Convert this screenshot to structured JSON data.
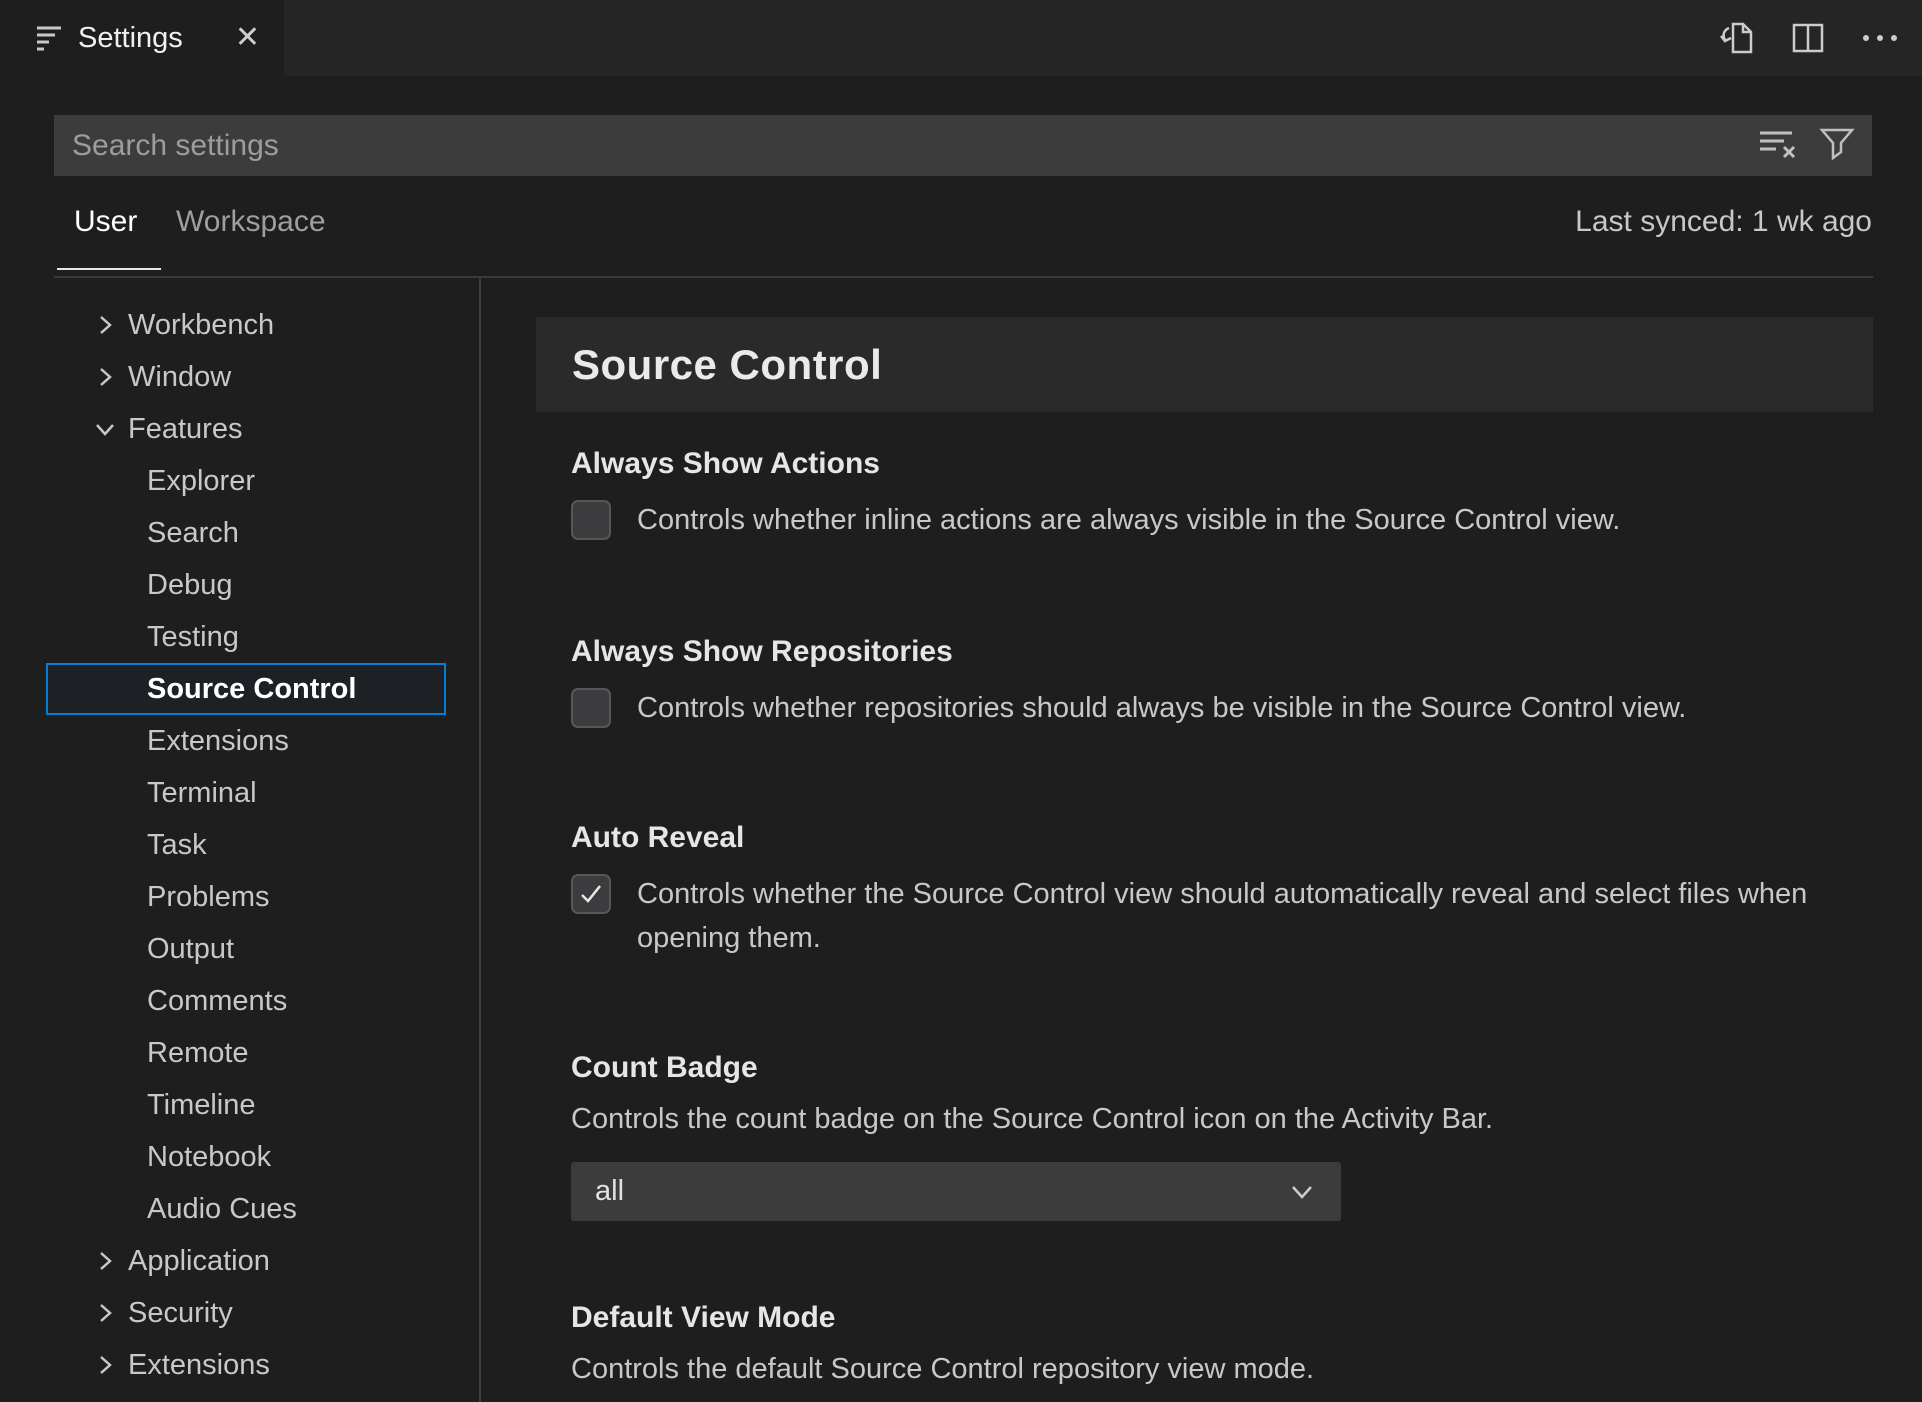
{
  "colors": {
    "background": "#1e1e1e",
    "tabbar_background": "#252526",
    "input_background": "#3c3c3c",
    "focus_border": "#007fd4",
    "heading_strip": "#2a2a2b"
  },
  "tab": {
    "title": "Settings",
    "close_glyph": "✕"
  },
  "editor_actions": {
    "open_settings_json_icon": "file-with-curved-arrow",
    "split_editor_icon": "two-pane-rectangle",
    "more_actions_icon": "ellipsis"
  },
  "search": {
    "placeholder": "Search settings",
    "clear_icon": "lines-with-x",
    "filter_icon": "funnel"
  },
  "scope": {
    "user_label": "User",
    "workspace_label": "Workspace",
    "last_synced": "Last synced: 1 wk ago"
  },
  "toc": {
    "items": [
      {
        "label": "Workbench",
        "level": 1,
        "chevron": "right",
        "selected": false
      },
      {
        "label": "Window",
        "level": 1,
        "chevron": "right",
        "selected": false
      },
      {
        "label": "Features",
        "level": 1,
        "chevron": "down",
        "selected": false
      },
      {
        "label": "Explorer",
        "level": 2,
        "chevron": "none",
        "selected": false
      },
      {
        "label": "Search",
        "level": 2,
        "chevron": "none",
        "selected": false
      },
      {
        "label": "Debug",
        "level": 2,
        "chevron": "none",
        "selected": false
      },
      {
        "label": "Testing",
        "level": 2,
        "chevron": "none",
        "selected": false
      },
      {
        "label": "Source Control",
        "level": 2,
        "chevron": "none",
        "selected": true
      },
      {
        "label": "Extensions",
        "level": 2,
        "chevron": "none",
        "selected": false
      },
      {
        "label": "Terminal",
        "level": 2,
        "chevron": "none",
        "selected": false
      },
      {
        "label": "Task",
        "level": 2,
        "chevron": "none",
        "selected": false
      },
      {
        "label": "Problems",
        "level": 2,
        "chevron": "none",
        "selected": false
      },
      {
        "label": "Output",
        "level": 2,
        "chevron": "none",
        "selected": false
      },
      {
        "label": "Comments",
        "level": 2,
        "chevron": "none",
        "selected": false
      },
      {
        "label": "Remote",
        "level": 2,
        "chevron": "none",
        "selected": false
      },
      {
        "label": "Timeline",
        "level": 2,
        "chevron": "none",
        "selected": false
      },
      {
        "label": "Notebook",
        "level": 2,
        "chevron": "none",
        "selected": false
      },
      {
        "label": "Audio Cues",
        "level": 2,
        "chevron": "none",
        "selected": false
      },
      {
        "label": "Application",
        "level": 1,
        "chevron": "right",
        "selected": false
      },
      {
        "label": "Security",
        "level": 1,
        "chevron": "right",
        "selected": false
      },
      {
        "label": "Extensions",
        "level": 1,
        "chevron": "right",
        "selected": false
      }
    ]
  },
  "content": {
    "heading": "Source Control",
    "settings": [
      {
        "title": "Always Show Actions",
        "type": "checkbox",
        "checked": false,
        "description": "Controls whether inline actions are always visible in the Source Control view."
      },
      {
        "title": "Always Show Repositories",
        "type": "checkbox",
        "checked": false,
        "description": "Controls whether repositories should always be visible in the Source Control view."
      },
      {
        "title": "Auto Reveal",
        "type": "checkbox",
        "checked": true,
        "description": "Controls whether the Source Control view should automatically reveal and select files when opening them."
      },
      {
        "title": "Count Badge",
        "type": "select",
        "value": "all",
        "description": "Controls the count badge on the Source Control icon on the Activity Bar."
      },
      {
        "title": "Default View Mode",
        "type": "select",
        "description": "Controls the default Source Control repository view mode."
      }
    ]
  }
}
